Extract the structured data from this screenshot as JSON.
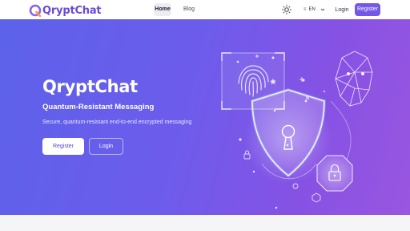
{
  "app": {
    "name": "QryptChat"
  },
  "nav": {
    "links": [
      {
        "label": "Home",
        "active": true
      },
      {
        "label": "Blog",
        "active": false
      }
    ],
    "theme_icon": "sun-icon",
    "language": {
      "icon": "translate-icon",
      "value": "EN"
    },
    "login_label": "Login",
    "register_label": "Register"
  },
  "hero": {
    "title": "QryptChat",
    "subtitle": "Quantum-Resistant Messaging",
    "description": "Secure, quantum-resistant end-to-end encrypted messaging",
    "register_label": "Register",
    "login_label": "Login",
    "illustration_icons": [
      "fingerprint-icon",
      "shield-keyhole-icon",
      "face-mesh-icon",
      "padlock-icon"
    ]
  },
  "colors": {
    "brand": "#6a4ad8",
    "accent": "#7357e8",
    "hero_gradient_start": "#5c62ea",
    "hero_gradient_end": "#9a56e0"
  }
}
